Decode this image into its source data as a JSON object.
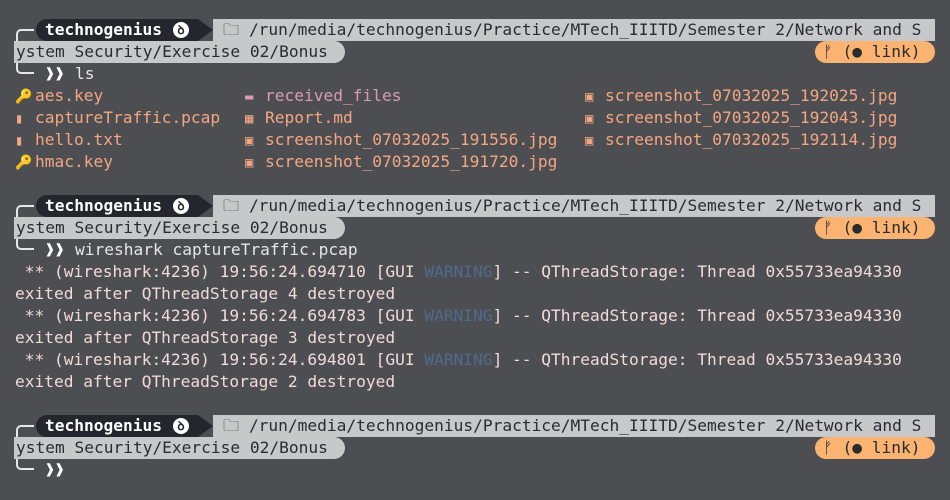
{
  "prompts": [
    {
      "user": "technogenius",
      "os_icon": "linux-distro-icon",
      "folder_icon": "folder-icon",
      "path_part1": "/run/media/technogenius/Practice/MTech_IIITD/Semester 2/Network and S",
      "path_part2": "ystem Security/Exercise 02/Bonus",
      "git": "(● link)",
      "command": "ls"
    },
    {
      "user": "technogenius",
      "path_part1": "/run/media/technogenius/Practice/MTech_IIITD/Semester 2/Network and S",
      "path_part2": "ystem Security/Exercise 02/Bonus",
      "git": "(● link)",
      "command": "wireshark captureTraffic.pcap"
    },
    {
      "user": "technogenius",
      "path_part1": "/run/media/technogenius/Practice/MTech_IIITD/Semester 2/Network and S",
      "path_part2": "ystem Security/Exercise 02/Bonus",
      "git": "(● link)",
      "command": ""
    }
  ],
  "prompt_symbol": "❱❱",
  "git_branch_icon": "ᚠ",
  "ls": {
    "col1": [
      {
        "name": "aes.key",
        "icon": "🔑"
      },
      {
        "name": "captureTraffic.pcap",
        "icon": "▮"
      },
      {
        "name": "hello.txt",
        "icon": "▮"
      },
      {
        "name": "hmac.key",
        "icon": "🔑"
      }
    ],
    "col2": [
      {
        "name": "received_files",
        "icon": "▬"
      },
      {
        "name": "Report.md",
        "icon": "▦"
      },
      {
        "name": "screenshot_07032025_191556.jpg",
        "icon": "▣"
      },
      {
        "name": "screenshot_07032025_191720.jpg",
        "icon": "▣"
      }
    ],
    "col3": [
      {
        "name": "screenshot_07032025_192025.jpg",
        "icon": "▣"
      },
      {
        "name": "screenshot_07032025_192043.jpg",
        "icon": "▣"
      },
      {
        "name": "screenshot_07032025_192114.jpg",
        "icon": "▣"
      }
    ]
  },
  "logs": [
    {
      "pre": " ** (wireshark:4236) 19:56:24.694710 [GUI ",
      "level": "WARNING",
      "post": "] -- QThreadStorage: Thread 0x55733ea94330",
      "cont": "exited after QThreadStorage 4 destroyed"
    },
    {
      "pre": " ** (wireshark:4236) 19:56:24.694783 [GUI ",
      "level": "WARNING",
      "post": "] -- QThreadStorage: Thread 0x55733ea94330",
      "cont": "exited after QThreadStorage 3 destroyed"
    },
    {
      "pre": " ** (wireshark:4236) 19:56:24.694801 [GUI ",
      "level": "WARNING",
      "post": "] -- QThreadStorage: Thread 0x55733ea94330",
      "cont": "exited after QThreadStorage 2 destroyed"
    }
  ]
}
